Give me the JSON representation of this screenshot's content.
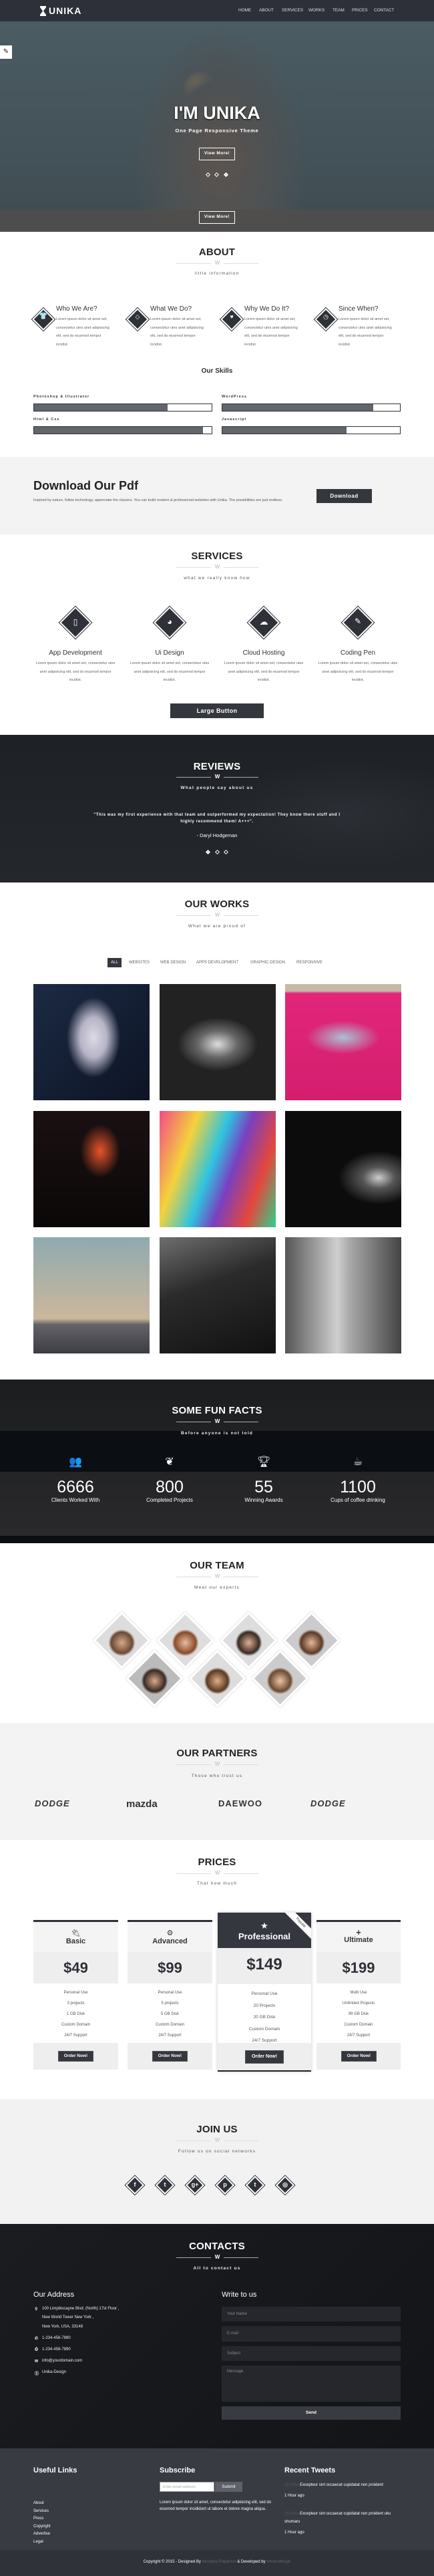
{
  "nav": {
    "brand": "UNIKA",
    "items": [
      "HOME",
      "ABOUT",
      "SERVICES",
      "WORKS",
      "TEAM",
      "PRICES",
      "CONTACT"
    ]
  },
  "hero": {
    "title": "I'M UNIKA",
    "subtitle": "One Page Responsive Theme",
    "button": "View More!",
    "button2": "View More!",
    "slides": 3,
    "active_slide": 3
  },
  "about": {
    "title": "ABOUT",
    "subtitle": "little information",
    "features": [
      {
        "icon": "shirt-icon",
        "title": "Who We Are?",
        "text": "Lorem ipsum dolor sit amet set, consectetur utes anet adipisicing elit, sed do eiusmod tempor incidist."
      },
      {
        "icon": "diamond-icon",
        "title": "What We Do?",
        "text": "Lorem ipsum dolor sit amet set, consectetur utes anet adipisicing elit, sed do eiusmod tempor incidist."
      },
      {
        "icon": "heart-icon",
        "title": "Why We Do It?",
        "text": "Lorem ipsum dolor sit amet set, consectetur utes anet adipisicing elit, sed do eiusmod tempor incidist."
      },
      {
        "icon": "clock-icon",
        "title": "Since When?",
        "text": "Lorem ipsum dolor sit amet set, consectetur utes anet adipisicing elit, sed do eiusmod tempor incidist."
      }
    ],
    "skills_title": "Our Skills",
    "skills": [
      {
        "label": "Photoshop & Illustrator",
        "percent": 75
      },
      {
        "label": "WordPress",
        "percent": 85
      },
      {
        "label": "Html & Css",
        "percent": 95
      },
      {
        "label": "Javascript",
        "percent": 70
      }
    ]
  },
  "pdf": {
    "title": "Download Our Pdf",
    "text": "Inspired by nature, follow technology, appreciate the classics. You can build modern & professional websites with Unika. The possibilities are just endless.",
    "button": "Download"
  },
  "services": {
    "title": "SERVICES",
    "subtitle": "what we really know how",
    "items": [
      {
        "icon": "mobile-icon",
        "title": "App Development",
        "text": "Lorem ipsum dolor sit amet set, consectetur utes anet adipisicing elit, sed do eiusmod tempor incidist."
      },
      {
        "icon": "pie-chart-icon",
        "title": "Ui Design",
        "text": "Lorem ipsum dolor sit amet set, consectetur utes anet adipisicing elit, sed do eiusmod tempor incidist."
      },
      {
        "icon": "cloud-icon",
        "title": "Cloud Hosting",
        "text": "Lorem ipsum dolor sit amet set, consectetur utes anet adipisicing elit, sed do eiusmod tempor incidist."
      },
      {
        "icon": "pencil-icon",
        "title": "Coding Pen",
        "text": "Lorem ipsum dolor sit amet set, consectetur utes anet adipisicing elit, sed do eiusmod tempor incidist."
      }
    ],
    "button": "Large Button"
  },
  "reviews": {
    "title": "REVIEWS",
    "subtitle": "What people say about us",
    "quote": "\"This was my first experience with that team and outperformed my expectation! They know there stuff and I highly recommend them! A+++\".",
    "author": "- Daryl Hodgeman",
    "slides": 3,
    "active_slide": 1
  },
  "works": {
    "title": "OUR WORKS",
    "subtitle": "What we are proud of",
    "filters": [
      "ALL",
      "WEBSITES",
      "WEB DESIGN",
      "APPS DEVELOPMENT",
      "GRAPHIC DESIGN",
      "RESPONSIVE"
    ],
    "active_filter": "ALL",
    "items": 9
  },
  "facts": {
    "title": "SOME FUN FACTS",
    "subtitle": "Before anyone is not told",
    "items": [
      {
        "icon": "users-icon",
        "value": "6666",
        "label": "Clients Worked With"
      },
      {
        "icon": "leaf-icon",
        "value": "800",
        "label": "Completed Projects"
      },
      {
        "icon": "trophy-icon",
        "value": "55",
        "label": "Winning Awards"
      },
      {
        "icon": "coffee-icon",
        "value": "1100",
        "label": "Cups of coffee drinking"
      }
    ]
  },
  "team": {
    "title": "OUR TEAM",
    "subtitle": "Meat our experts",
    "members": 7
  },
  "partners": {
    "title": "OUR PARTNERS",
    "subtitle": "Those who trust us",
    "logos": [
      "DODGE",
      "mazda",
      "DAEWOO",
      "DODGE"
    ]
  },
  "prices": {
    "title": "PRICES",
    "subtitle": "That how much",
    "plans": [
      {
        "icon": "plug-icon",
        "name": "Basic",
        "price": "$49",
        "features": [
          "Personal Use",
          "3 projects",
          "1 GB Disk",
          "Custom Domain",
          "24/7 Support"
        ],
        "button": "Order Now!"
      },
      {
        "icon": "gear-icon",
        "name": "Advanced",
        "price": "$99",
        "features": [
          "Personal Use",
          "5 projects",
          "5 GB Disk",
          "Custom Domain",
          "24/7 Support"
        ],
        "button": "Order Now!"
      },
      {
        "icon": "star-icon",
        "name": "Professional",
        "price": "$149",
        "badge": "Popular",
        "features": [
          "Personal Use",
          "20 Projects",
          "20 GB Disk",
          "Custom Domain",
          "24/7 Support"
        ],
        "button": "Order Now!"
      },
      {
        "icon": "plus-icon",
        "name": "Ultimate",
        "price": "$199",
        "features": [
          "Multi Use",
          "Unlimited Projects",
          "99 GB Disk",
          "Custom Domain",
          "24/7 Support"
        ],
        "button": "Order Now!"
      }
    ]
  },
  "join": {
    "title": "JOIN US",
    "subtitle": "Follow us on social networks",
    "icons": [
      {
        "name": "facebook-icon",
        "glyph": "f"
      },
      {
        "name": "twitter-icon",
        "glyph": "t"
      },
      {
        "name": "google-plus-icon",
        "glyph": "g+"
      },
      {
        "name": "pinterest-icon",
        "glyph": "p"
      },
      {
        "name": "tumblr-icon",
        "glyph": "t"
      },
      {
        "name": "dribbble-icon",
        "glyph": "◎"
      }
    ]
  },
  "contacts": {
    "title": "CONTACTS",
    "subtitle": "All to contact us",
    "address_title": "Our Address",
    "address": [
      "100 Limpbiscayne Blvd. (North) 17st Floor ,",
      "New World Tower New York ,",
      "New York, USA, 33148"
    ],
    "phone": "1-234-456-7890",
    "fax": "1-234-456-7890",
    "email": "info@yourdomain.com",
    "skype": "Unika-Design",
    "form_title": "Write to us",
    "name_placeholder": "Your Name",
    "email_placeholder": "E-mail",
    "subject_placeholder": "Subject",
    "message_placeholder": "Message",
    "send": "Send"
  },
  "footer": {
    "links_title": "Useful Links",
    "links": [
      "About",
      "Services",
      "Press",
      "Copyright",
      "Advertise",
      "Legal"
    ],
    "subscribe_title": "Subscribe",
    "subscribe_placeholder": "Enter email address",
    "subscribe_button": "Submit",
    "subscribe_text": "Lorem ipsum dolor sit amet, consectetur adipisicing elit, sed do eiusmod tempor incididunt ut labore et dolore magna aliqua.",
    "tweets_title": "Recent Tweets",
    "tweets": [
      {
        "handle": "@Unika",
        "text": "Excepteur sint occaecat cupidatat non proident",
        "time": "1 Hour ago"
      },
      {
        "handle": "@Unika",
        "text": "Excepteur sint occaecat cupidatat non proident uku shumaru",
        "time": "1 Hour ago"
      }
    ],
    "copy_prefix": "Copyright © 2015 - Designed By",
    "designer": "Veronika Poljakova",
    "copy_mid": "& Developed by",
    "developer": "Imransdesign"
  }
}
